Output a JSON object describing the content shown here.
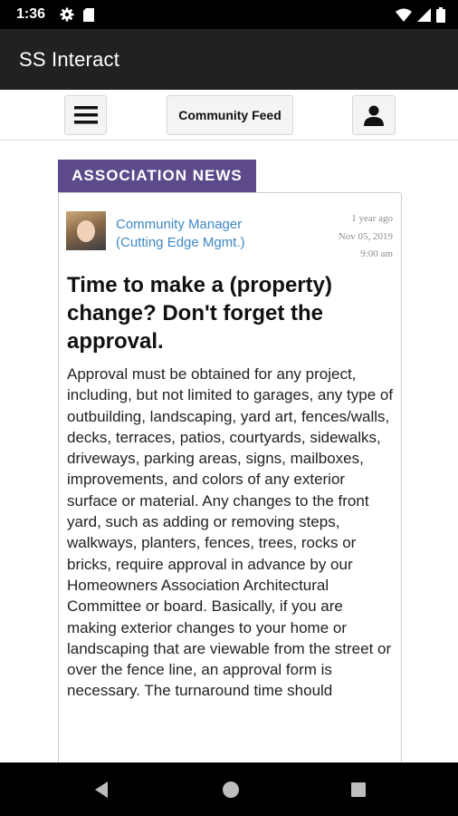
{
  "status_bar": {
    "time": "1:36",
    "icons": [
      "gear-icon",
      "sd-card-icon",
      "wifi-icon",
      "signal-icon",
      "battery-icon"
    ]
  },
  "app_bar": {
    "title": "SS Interact"
  },
  "toolbar": {
    "menu_icon": "hamburger-menu-icon",
    "feed_label": "Community Feed",
    "profile_icon": "person-icon"
  },
  "section": {
    "tab_label": "ASSOCIATION NEWS",
    "tab_color": "#5c4a8a"
  },
  "post": {
    "author_line1": "Community Manager",
    "author_line2": "(Cutting Edge Mgmt.)",
    "relative_time": "1 year ago",
    "date": "Nov 05, 2019",
    "time": "9:00 am",
    "title": "Time to make a (property) change? Don't forget the approval.",
    "body": "Approval must be obtained for any project, including, but not limited to garages, any type of outbuilding, landscaping, yard art, fences/walls, decks, terraces, patios, courtyards, sidewalks, driveways, parking areas, signs, mailboxes, improvements, and colors of any exterior surface or material. Any changes to the front yard, such as adding or removing steps, walkways, planters, fences, trees, rocks or bricks, require approval in advance by our Homeowners Association Architectural Committee or board. Basically, if you are making exterior changes to your home or landscaping that are viewable from the street or over the fence line, an approval form is necessary. The turnaround time should",
    "link_color": "#3f88c5"
  },
  "nav_bar": {
    "icons": [
      "back-icon",
      "home-icon",
      "recents-icon"
    ]
  }
}
